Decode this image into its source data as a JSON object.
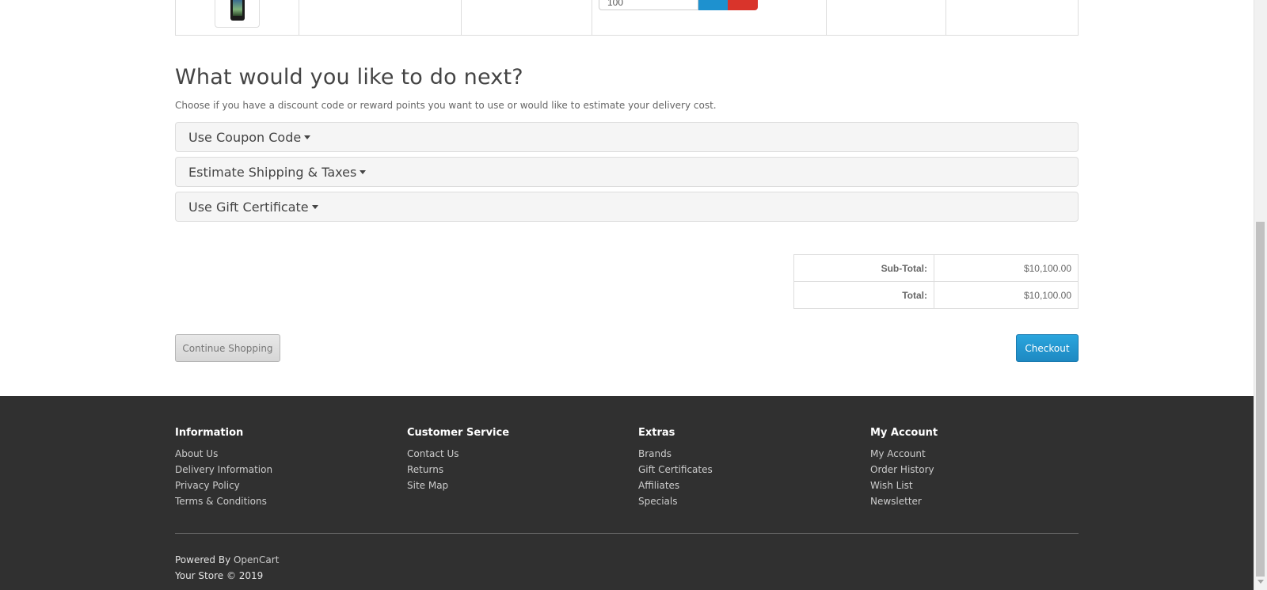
{
  "cart": {
    "quantity_value": "100"
  },
  "next": {
    "title": "What would you like to do next?",
    "description": "Choose if you have a discount code or reward points you want to use or would like to estimate your delivery cost.",
    "panels": [
      {
        "label": "Use Coupon Code"
      },
      {
        "label": "Estimate Shipping & Taxes"
      },
      {
        "label": "Use Gift Certificate"
      }
    ]
  },
  "totals": [
    {
      "label": "Sub-Total:",
      "value": "$10,100.00"
    },
    {
      "label": "Total:",
      "value": "$10,100.00"
    }
  ],
  "buttons": {
    "continue": "Continue Shopping",
    "checkout": "Checkout"
  },
  "footer": {
    "columns": [
      {
        "heading": "Information",
        "links": [
          "About Us",
          "Delivery Information",
          "Privacy Policy",
          "Terms & Conditions"
        ]
      },
      {
        "heading": "Customer Service",
        "links": [
          "Contact Us",
          "Returns",
          "Site Map"
        ]
      },
      {
        "heading": "Extras",
        "links": [
          "Brands",
          "Gift Certificates",
          "Affiliates",
          "Specials"
        ]
      },
      {
        "heading": "My Account",
        "links": [
          "My Account",
          "Order History",
          "Wish List",
          "Newsletter"
        ]
      }
    ],
    "powered_prefix": "Powered By ",
    "powered_link": "OpenCart",
    "copyright": "Your Store © 2019"
  },
  "colors": {
    "primary": "#1e91cf",
    "danger": "#d9342b",
    "footer_bg": "#303030"
  }
}
